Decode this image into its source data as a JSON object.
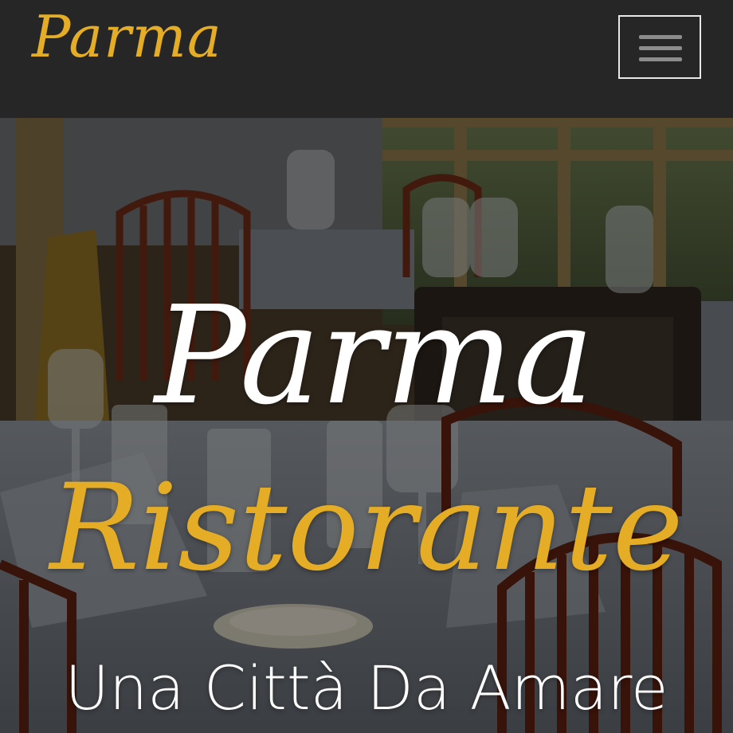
{
  "navbar": {
    "brand": "Parma",
    "menu_toggle_icon": "hamburger-menu-icon"
  },
  "hero": {
    "title": "Parma",
    "subtitle": "Ristorante",
    "tagline": "Una Città Da Amare"
  },
  "colors": {
    "navbar_bg": "#262626",
    "brand_gold": "#e5ad25",
    "hero_title": "#ffffff",
    "menu_border": "#e8e8e8",
    "menu_bars": "#8c8c8c"
  }
}
